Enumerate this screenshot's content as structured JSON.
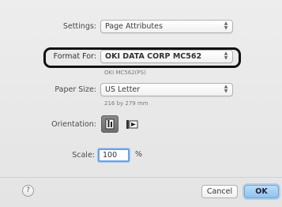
{
  "settings": {
    "label": "Settings:",
    "value": "Page Attributes"
  },
  "format_for": {
    "label": "Format For:",
    "value": "OKI DATA CORP MC562",
    "note": "OKI MC562(PS)"
  },
  "paper_size": {
    "label": "Paper Size:",
    "value": "US Letter",
    "note": "216 by 279 mm"
  },
  "orientation": {
    "label": "Orientation:",
    "selected": "portrait"
  },
  "scale": {
    "label": "Scale:",
    "value": "100",
    "unit": "%"
  },
  "footer": {
    "help_label": "?",
    "cancel_label": "Cancel",
    "ok_label": "OK"
  },
  "colors": {
    "ok_accent": "#8fc2ef",
    "focus_ring": "#6aa3e6",
    "highlight_ring": "#111111"
  }
}
